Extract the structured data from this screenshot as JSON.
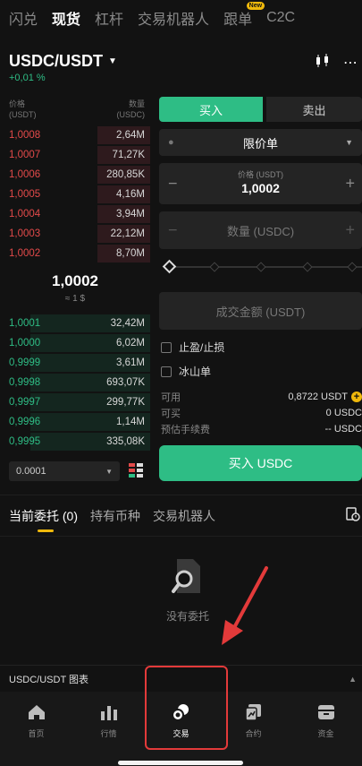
{
  "top_nav": {
    "tabs": [
      "闪兑",
      "现货",
      "杠杆",
      "交易机器人",
      "跟单",
      "C2C"
    ],
    "active": "现货",
    "new_badge": "New"
  },
  "pair": {
    "name": "USDC/USDT",
    "change": "+0,01 %"
  },
  "orderbook": {
    "price_header": "价格",
    "price_unit": "(USDT)",
    "qty_header": "数量",
    "qty_unit": "(USDC)",
    "asks": [
      {
        "price": "1,0008",
        "qty": "2,64M",
        "depth": 0.35
      },
      {
        "price": "1,0007",
        "qty": "71,27K",
        "depth": 0.35
      },
      {
        "price": "1,0006",
        "qty": "280,85K",
        "depth": 0.35
      },
      {
        "price": "1,0005",
        "qty": "4,16M",
        "depth": 0.35
      },
      {
        "price": "1,0004",
        "qty": "3,94M",
        "depth": 0.35
      },
      {
        "price": "1,0003",
        "qty": "22,12M",
        "depth": 0.35
      },
      {
        "price": "1,0002",
        "qty": "8,70M",
        "depth": 0.35
      }
    ],
    "mid_price": "1,0002",
    "mid_usd": "≈ 1 $",
    "bids": [
      {
        "price": "1,0001",
        "qty": "32,42M",
        "depth": 0.8
      },
      {
        "price": "1,0000",
        "qty": "6,02M",
        "depth": 0.8
      },
      {
        "price": "0,9999",
        "qty": "3,61M",
        "depth": 0.8
      },
      {
        "price": "0,9998",
        "qty": "693,07K",
        "depth": 0.8
      },
      {
        "price": "0,9997",
        "qty": "299,77K",
        "depth": 0.8
      },
      {
        "price": "0,9996",
        "qty": "1,14M",
        "depth": 0.8
      },
      {
        "price": "0,9995",
        "qty": "335,08K",
        "depth": 0.8
      }
    ],
    "precision": "0.0001"
  },
  "order_form": {
    "buy_tab": "买入",
    "sell_tab": "卖出",
    "order_type": "限价单",
    "price_label": "价格 (USDT)",
    "price_value": "1,0002",
    "qty_placeholder": "数量 (USDC)",
    "total_placeholder": "成交金额 (USDT)",
    "tp_sl_label": "止盈/止损",
    "iceberg_label": "冰山单",
    "available_label": "可用",
    "available_value": "0,8722 USDT",
    "can_buy_label": "可买",
    "can_buy_value": "0 USDC",
    "fee_label": "预估手续费",
    "fee_value": "-- USDC",
    "buy_button": "买入 USDC"
  },
  "orders": {
    "tabs": [
      "当前委托 (0)",
      "持有币种",
      "交易机器人"
    ],
    "empty_label": "没有委托"
  },
  "chart_bar": {
    "label": "USDC/USDT 图表"
  },
  "bottom_nav": {
    "items": [
      "首页",
      "行情",
      "交易",
      "合约",
      "资金"
    ],
    "active": "交易"
  },
  "colors": {
    "accent_green": "#2ebd85",
    "ask_red": "#e34a4a",
    "brand_yellow": "#f0b90b",
    "annotation_red": "#e33a3a"
  }
}
